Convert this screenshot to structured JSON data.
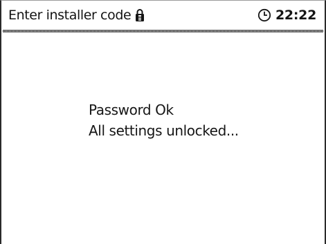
{
  "header": {
    "title": "Enter installer code",
    "lock_icon": "lock-icon",
    "clock_icon": "clock-icon",
    "time": "22:22"
  },
  "message": {
    "line1": "Password Ok",
    "line2": "All settings unlocked..."
  }
}
